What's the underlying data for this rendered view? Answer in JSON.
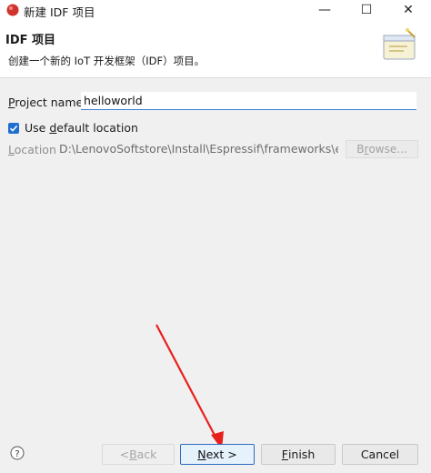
{
  "window": {
    "title": "新建 IDF 项目",
    "minimize_glyph": "—",
    "maximize_glyph": "☐",
    "close_glyph": "✕"
  },
  "banner": {
    "title": "IDF 项目",
    "description": "创建一个新的 IoT 开发框架（IDF）项目。"
  },
  "form": {
    "project_name_label_prefix": "",
    "project_name_label_mnemonic": "P",
    "project_name_label_rest": "roject name:",
    "project_name_value": "helloworld",
    "use_default_label_pre": "Use ",
    "use_default_label_mnemonic": "d",
    "use_default_label_rest": "efault location",
    "use_default_checked": true,
    "location_label_mnemonic": "L",
    "location_label_rest": "ocation:",
    "location_value": "D:\\LenovoSoftstore\\Install\\Espressif\\frameworks\\esp-i",
    "browse_label_pre": "B",
    "browse_label_mnemonic": "r",
    "browse_label_rest": "owse..."
  },
  "buttons": {
    "back_pre": "< ",
    "back_mnemonic": "B",
    "back_rest": "ack",
    "next_mnemonic": "N",
    "next_rest": "ext >",
    "finish_mnemonic": "F",
    "finish_rest": "inish",
    "cancel": "Cancel"
  },
  "icons": {
    "app": "eclipse-red-orb-icon",
    "banner": "wizard-folder-icon",
    "help": "help-question-icon",
    "annotation": "red-arrow-icon"
  },
  "colors": {
    "accent": "#1e6fd0",
    "annotation_arrow": "#e8201c",
    "app_icon": "#d0342c"
  }
}
